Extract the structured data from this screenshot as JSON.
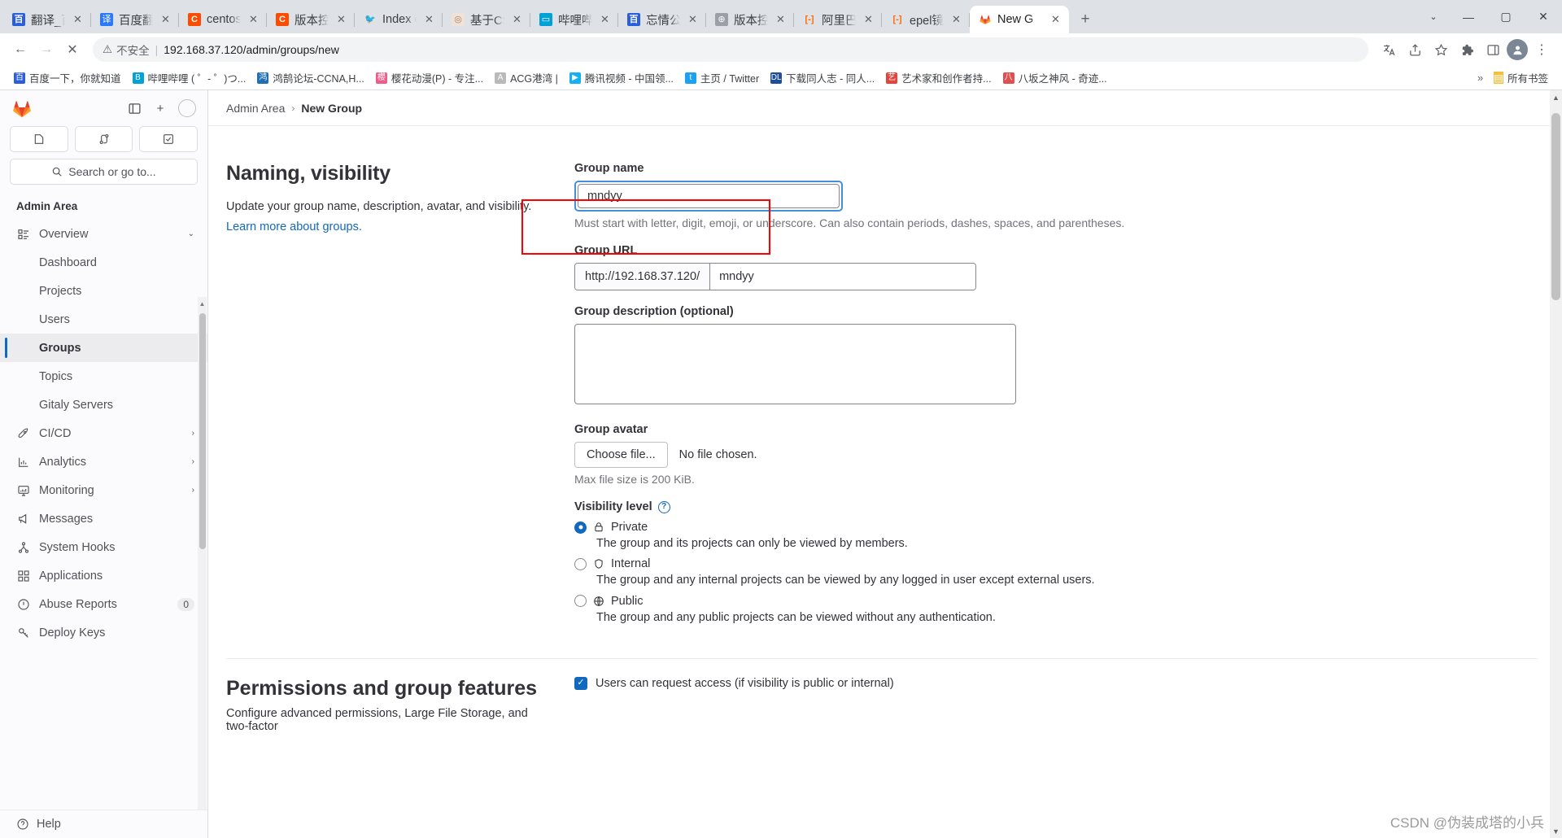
{
  "browser": {
    "tabs": [
      {
        "title": "翻译_百",
        "favicon": "baidu-icon",
        "active": false
      },
      {
        "title": "百度翻译",
        "favicon": "fanyi-icon",
        "active": false
      },
      {
        "title": "centos",
        "favicon": "csdn-c-icon",
        "active": false
      },
      {
        "title": "版本控",
        "favicon": "csdn-c-icon",
        "active": false
      },
      {
        "title": "Index of",
        "favicon": "bird-icon",
        "active": false
      },
      {
        "title": "基于CS",
        "favicon": "csdn-avatar-icon",
        "active": false
      },
      {
        "title": "哔哩哔",
        "favicon": "bilibili-icon",
        "active": false
      },
      {
        "title": "忘情公",
        "favicon": "baidu-icon",
        "active": false
      },
      {
        "title": "版本控",
        "favicon": "globe-icon",
        "active": false
      },
      {
        "title": "阿里巴",
        "favicon": "aliyun-icon",
        "active": false
      },
      {
        "title": "epel镜",
        "favicon": "aliyun-icon",
        "active": false
      },
      {
        "title": "New G",
        "favicon": "gitlab-icon",
        "active": true
      }
    ],
    "new_tab_label": "+",
    "window_controls": {
      "chevron": "⌄",
      "minimize": "—",
      "maximize": "▢",
      "close": "✕"
    },
    "toolbar": {
      "back": "←",
      "forward": "→",
      "stop": "✕",
      "security_label": "不安全",
      "url": "192.168.37.120/admin/groups/new",
      "translate_icon": "translate-icon",
      "share_icon": "share-icon",
      "bookmark_icon": "star-icon",
      "extensions_icon": "puzzle-icon",
      "sidepanel_icon": "side-panel-icon",
      "profile_icon": "profile-icon",
      "menu_icon": "kebab-menu-icon"
    },
    "bookmarks": [
      {
        "label": "百度一下，你就知道",
        "icon": "baidu-icon"
      },
      {
        "label": "哔哩哔哩 ( ゜- ゜)つ...",
        "icon": "bilibili-icon"
      },
      {
        "label": "鸿鹄论坛-CCNA,H...",
        "icon": "honghu-icon"
      },
      {
        "label": "樱花动漫(P) - 专注...",
        "icon": "sakura-icon"
      },
      {
        "label": "ACG港湾 |",
        "icon": "acg-icon"
      },
      {
        "label": "腾讯视频 - 中国领...",
        "icon": "tencent-video-icon"
      },
      {
        "label": "主页 / Twitter",
        "icon": "twitter-icon"
      },
      {
        "label": "下载同人志 - 同人...",
        "icon": "dl-icon"
      },
      {
        "label": "艺术家和创作者持...",
        "icon": "art-icon"
      },
      {
        "label": "八坂之神风 - 奇迹...",
        "icon": "yasaka-icon"
      }
    ],
    "bookmarks_overflow": "»",
    "bookmarks_all": "所有书签"
  },
  "gitlab": {
    "sidebar": {
      "logo": "gitlab-logo",
      "toggle_icon": "sidebar-toggle-icon",
      "new_icon": "+",
      "quick_actions": [
        {
          "icon": "issues-icon",
          "name": "issues"
        },
        {
          "icon": "merge-requests-icon",
          "name": "merge-requests"
        },
        {
          "icon": "todos-icon",
          "name": "todos"
        }
      ],
      "search_placeholder": "Search or go to...",
      "section_title": "Admin Area",
      "items": [
        {
          "label": "Overview",
          "icon": "overview-icon",
          "sub": false,
          "active": false,
          "chevron": "⌄",
          "badge": ""
        },
        {
          "label": "Dashboard",
          "icon": "",
          "sub": true,
          "active": false,
          "chevron": "",
          "badge": ""
        },
        {
          "label": "Projects",
          "icon": "",
          "sub": true,
          "active": false,
          "chevron": "",
          "badge": ""
        },
        {
          "label": "Users",
          "icon": "",
          "sub": true,
          "active": false,
          "chevron": "",
          "badge": ""
        },
        {
          "label": "Groups",
          "icon": "",
          "sub": true,
          "active": true,
          "chevron": "",
          "badge": ""
        },
        {
          "label": "Topics",
          "icon": "",
          "sub": true,
          "active": false,
          "chevron": "",
          "badge": ""
        },
        {
          "label": "Gitaly Servers",
          "icon": "",
          "sub": true,
          "active": false,
          "chevron": "",
          "badge": ""
        },
        {
          "label": "CI/CD",
          "icon": "rocket-icon",
          "sub": false,
          "active": false,
          "chevron": "›",
          "badge": ""
        },
        {
          "label": "Analytics",
          "icon": "chart-icon",
          "sub": false,
          "active": false,
          "chevron": "›",
          "badge": ""
        },
        {
          "label": "Monitoring",
          "icon": "monitor-icon",
          "sub": false,
          "active": false,
          "chevron": "›",
          "badge": ""
        },
        {
          "label": "Messages",
          "icon": "megaphone-icon",
          "sub": false,
          "active": false,
          "chevron": "",
          "badge": ""
        },
        {
          "label": "System Hooks",
          "icon": "hook-icon",
          "sub": false,
          "active": false,
          "chevron": "",
          "badge": ""
        },
        {
          "label": "Applications",
          "icon": "applications-icon",
          "sub": false,
          "active": false,
          "chevron": "",
          "badge": ""
        },
        {
          "label": "Abuse Reports",
          "icon": "abuse-icon",
          "sub": false,
          "active": false,
          "chevron": "",
          "badge": "0"
        },
        {
          "label": "Deploy Keys",
          "icon": "key-icon",
          "sub": false,
          "active": false,
          "chevron": "",
          "badge": ""
        }
      ],
      "help_label": "Help",
      "help_icon": "help-icon"
    },
    "breadcrumb": {
      "parent": "Admin Area",
      "separator": "›",
      "current": "New Group"
    },
    "naming_section": {
      "heading": "Naming, visibility",
      "description": "Update your group name, description, avatar, and visibility.",
      "learn_more": "Learn more about groups."
    },
    "form": {
      "group_name_label": "Group name",
      "group_name_value": "mndyy",
      "group_name_hint": "Must start with letter, digit, emoji, or underscore. Can also contain periods, dashes, spaces, and parentheses.",
      "group_url_label": "Group URL",
      "group_url_prefix": "http://192.168.37.120/",
      "group_url_value": "mndyy",
      "group_description_label": "Group description (optional)",
      "group_description_value": "",
      "group_avatar_label": "Group avatar",
      "choose_file_label": "Choose file...",
      "no_file_label": "No file chosen.",
      "max_size_hint": "Max file size is 200 KiB.",
      "visibility_label": "Visibility level",
      "visibility_help_icon": "?",
      "visibility_options": [
        {
          "label": "Private",
          "icon": "lock-icon",
          "selected": true,
          "description": "The group and its projects can only be viewed by members."
        },
        {
          "label": "Internal",
          "icon": "shield-icon",
          "selected": false,
          "description": "The group and any internal projects can be viewed by any logged in user except external users."
        },
        {
          "label": "Public",
          "icon": "globe-icon",
          "selected": false,
          "description": "The group and any public projects can be viewed without any authentication."
        }
      ]
    },
    "permissions_section": {
      "heading": "Permissions and group features",
      "description": "Configure advanced permissions, Large File Storage, and two-factor",
      "request_access_label": "Users can request access (if visibility is public or internal)",
      "request_access_checked": true,
      "check_glyph": "✓"
    }
  },
  "watermark": "CSDN @伪装成塔的小兵"
}
